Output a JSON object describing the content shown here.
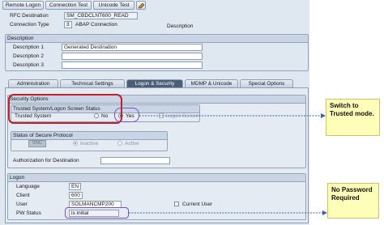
{
  "toolbar": {
    "remote_logon": "Remote Logon",
    "connection_test": "Connection Test",
    "unicode_test": "Unicode Test"
  },
  "header": {
    "rfc_destination_label": "RFC Destination",
    "rfc_destination_value": "SM_CBDCLNT600_READ",
    "connection_type_label": "Connection Type",
    "connection_type_code": "3",
    "connection_type_value": "ABAP Connection",
    "description_label": "Description"
  },
  "description": {
    "title": "Description",
    "desc1_label": "Description 1",
    "desc1_value": "Generated Destination",
    "desc2_label": "Description 2",
    "desc2_value": "",
    "desc3_label": "Description 3",
    "desc3_value": ""
  },
  "tabs": [
    "Administration",
    "Technical Settings",
    "Logon & Security",
    "MDMP & Unicode",
    "Special Options"
  ],
  "active_tab": 2,
  "security": {
    "title": "Security Options",
    "trusted_group_title": "Trusted System/Logon Screen Status",
    "trusted_label": "Trusted System",
    "no_label": "No",
    "yes_label": "Yes",
    "logon_screen_label": "Logon Screen",
    "protocol_title": "Status of Secure Protocol",
    "snc_button": "SNC",
    "inactive_label": "Inactive",
    "active_label": "Active",
    "auth_label": "Authorization for Destination",
    "auth_value": ""
  },
  "logon": {
    "title": "Logon",
    "language_label": "Language",
    "language_value": "EN",
    "client_label": "Client",
    "client_value": "600",
    "user_label": "User",
    "user_value": "SOLMANCMP200",
    "current_user_label": "Current User",
    "pw_label": "PW Status",
    "pw_value": "is initial"
  },
  "callouts": {
    "trusted": "Switch to Trusted mode.",
    "password": "No Password Required"
  },
  "colors": {
    "annotation": "#c0202a",
    "arrow": "#3a5fb0",
    "callout_bg": "#fffeb8",
    "active_tab": "#4b5e78"
  }
}
